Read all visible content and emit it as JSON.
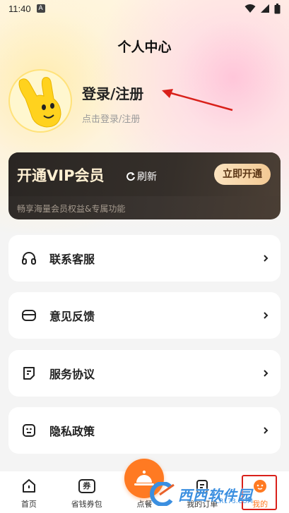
{
  "status_bar": {
    "time": "11:40",
    "notification": "A"
  },
  "header": {
    "title": "个人中心"
  },
  "profile": {
    "login_label": "登录/注册",
    "login_hint": "点击登录/注册"
  },
  "vip": {
    "title": "开通VIP会员",
    "refresh_label": "刷新",
    "open_button": "立即开通",
    "description": "畅享海量会员权益&专属功能"
  },
  "menu": [
    {
      "label": "联系客服",
      "icon": "headset-icon"
    },
    {
      "label": "意见反馈",
      "icon": "feedback-icon"
    },
    {
      "label": "服务协议",
      "icon": "agreement-icon"
    },
    {
      "label": "隐私政策",
      "icon": "privacy-icon"
    }
  ],
  "nav": [
    {
      "label": "首页",
      "icon": "home-icon"
    },
    {
      "label": "省钱券包",
      "icon": "coupon-icon"
    },
    {
      "label": "点餐",
      "icon": "dining-bell-icon"
    },
    {
      "label": "我的订单",
      "icon": "orders-icon"
    },
    {
      "label": "我的",
      "icon": "profile-icon"
    }
  ],
  "nav_coupon_glyph": "券",
  "watermark": {
    "text": "西西软件园",
    "sub": "CR173.COM"
  },
  "colors": {
    "accent": "#ff7a22",
    "vip_bg": "#2e2a27",
    "vip_gold": "#f3c994",
    "annotation_red": "#d9201a"
  }
}
